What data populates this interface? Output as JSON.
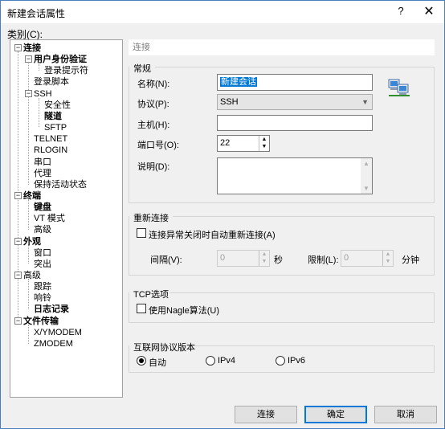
{
  "window": {
    "title": "新建会话属性",
    "help": "?",
    "close": "✕"
  },
  "category_label": "类别(C):",
  "tree": [
    {
      "label": "连接",
      "bold": true,
      "expander": "−"
    },
    {
      "label": "用户身份验证",
      "bold": true,
      "expander": "−"
    },
    {
      "label": "登录提示符",
      "bold": false
    },
    {
      "label": "登录脚本",
      "bold": false
    },
    {
      "label": "SSH",
      "bold": false,
      "expander": "−"
    },
    {
      "label": "安全性",
      "bold": false
    },
    {
      "label": "隧道",
      "bold": true
    },
    {
      "label": "SFTP",
      "bold": false
    },
    {
      "label": "TELNET",
      "bold": false
    },
    {
      "label": "RLOGIN",
      "bold": false
    },
    {
      "label": "串口",
      "bold": false
    },
    {
      "label": "代理",
      "bold": false
    },
    {
      "label": "保持活动状态",
      "bold": false
    },
    {
      "label": "终端",
      "bold": true,
      "expander": "−"
    },
    {
      "label": "键盘",
      "bold": true
    },
    {
      "label": "VT 模式",
      "bold": false
    },
    {
      "label": "高级",
      "bold": false
    },
    {
      "label": "外观",
      "bold": true,
      "expander": "−"
    },
    {
      "label": "窗口",
      "bold": false
    },
    {
      "label": "突出",
      "bold": false
    },
    {
      "label": "高级",
      "bold": false,
      "expander": "−"
    },
    {
      "label": "跟踪",
      "bold": false
    },
    {
      "label": "响铃",
      "bold": false
    },
    {
      "label": "日志记录",
      "bold": true
    },
    {
      "label": "文件传输",
      "bold": true,
      "expander": "−"
    },
    {
      "label": "X/YMODEM",
      "bold": false
    },
    {
      "label": "ZMODEM",
      "bold": false
    }
  ],
  "section_header": "连接",
  "general": {
    "group_title": "常规",
    "name_label": "名称(N):",
    "name_value": "新建会话",
    "protocol_label": "协议(P):",
    "protocol_value": "SSH",
    "host_label": "主机(H):",
    "host_value": "",
    "port_label": "端口号(O):",
    "port_value": "22",
    "desc_label": "说明(D):",
    "desc_value": ""
  },
  "reconnect": {
    "group_title": "重新连接",
    "auto_reconnect_label": "连接异常关闭时自动重新连接(A)",
    "auto_reconnect_checked": false,
    "interval_label": "间隔(V):",
    "interval_value": "0",
    "interval_unit": "秒",
    "limit_label": "限制(L):",
    "limit_value": "0",
    "limit_unit": "分钟"
  },
  "tcp": {
    "group_title": "TCP选项",
    "nagle_label": "使用Nagle算法(U)",
    "nagle_checked": false
  },
  "ip_version": {
    "group_title": "互联网协议版本",
    "options": [
      "自动",
      "IPv4",
      "IPv6"
    ],
    "selected": "自动"
  },
  "buttons": {
    "connect": "连接",
    "ok": "确定",
    "cancel": "取消"
  },
  "colors": {
    "accent": "#0078d7",
    "window_bg": "#f0f0f0"
  },
  "icons": {
    "network": "network-computers-icon"
  }
}
